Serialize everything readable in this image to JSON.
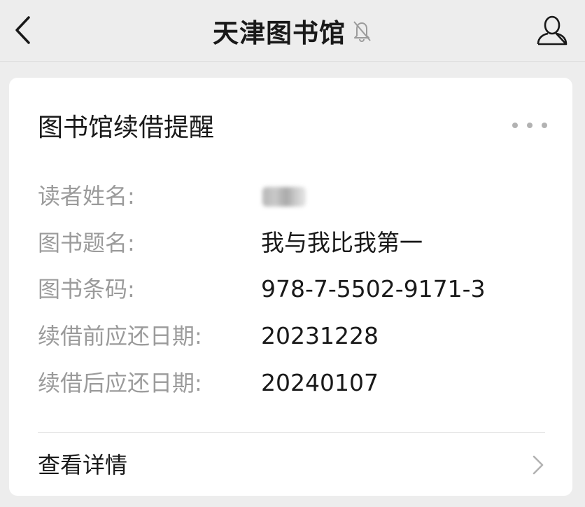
{
  "nav": {
    "title": "天津图书馆",
    "back_icon": "chevron-left-icon",
    "mute_icon": "bell-muted-icon",
    "profile_icon": "person-icon"
  },
  "card": {
    "title": "图书馆续借提醒",
    "more_icon": "ellipsis-icon",
    "fields": [
      {
        "label": "读者姓名:",
        "value": "",
        "redacted": true
      },
      {
        "label": "图书题名:",
        "value": "我与我比我第一"
      },
      {
        "label": "图书条码:",
        "value": "978-7-5502-9171-3"
      },
      {
        "label": "续借前应还日期:",
        "value": "20231228"
      },
      {
        "label": "续借后应还日期:",
        "value": "20240107"
      }
    ],
    "details_label": "查看详情",
    "details_icon": "chevron-right-icon"
  },
  "colors": {
    "background": "#ededed",
    "card": "#ffffff",
    "label_text": "#9b9b9b",
    "value_text": "#191919"
  }
}
